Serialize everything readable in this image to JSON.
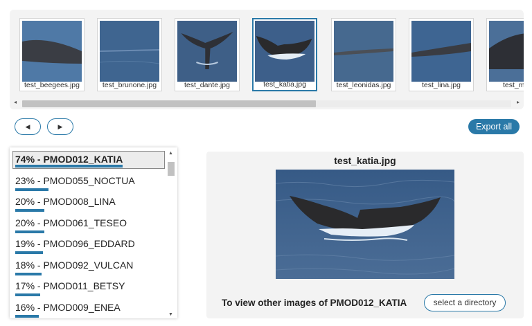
{
  "gallery": {
    "thumbnails": [
      {
        "filename": "test_beegees.jpg",
        "selected": false
      },
      {
        "filename": "test_brunone.jpg",
        "selected": false
      },
      {
        "filename": "test_dante.jpg",
        "selected": false
      },
      {
        "filename": "test_katia.jpg",
        "selected": true
      },
      {
        "filename": "test_leonidas.jpg",
        "selected": false
      },
      {
        "filename": "test_lina.jpg",
        "selected": false
      },
      {
        "filename": "test_mark",
        "selected": false
      }
    ],
    "scroll_left_icon": "◂",
    "scroll_right_icon": "▸"
  },
  "nav": {
    "prev_icon": "◀",
    "next_icon": "▶",
    "export_label": "Export all"
  },
  "results": [
    {
      "label": "74% - PMOD012_KATIA",
      "score": 0.74,
      "selected": true
    },
    {
      "label": "23% - PMOD055_NOCTUA",
      "score": 0.23,
      "selected": false
    },
    {
      "label": "20% - PMOD008_LINA",
      "score": 0.2,
      "selected": false
    },
    {
      "label": "20% - PMOD061_TESEO",
      "score": 0.2,
      "selected": false
    },
    {
      "label": "19% - PMOD096_EDDARD",
      "score": 0.19,
      "selected": false
    },
    {
      "label": "18% - PMOD092_VULCAN",
      "score": 0.18,
      "selected": false
    },
    {
      "label": "17% - PMOD011_BETSY",
      "score": 0.17,
      "selected": false
    },
    {
      "label": "16% - PMOD009_ENEA",
      "score": 0.16,
      "selected": false
    }
  ],
  "results_scroll": {
    "up_icon": "▲",
    "down_icon": "▼"
  },
  "preview": {
    "title": "test_katia.jpg",
    "hint": "To view other images of PMOD012_KATIA",
    "directory_button": "select a directory"
  },
  "colors": {
    "accent": "#2a79a8",
    "panel": "#f3f3f3",
    "ocean": "#3d5f8a"
  }
}
